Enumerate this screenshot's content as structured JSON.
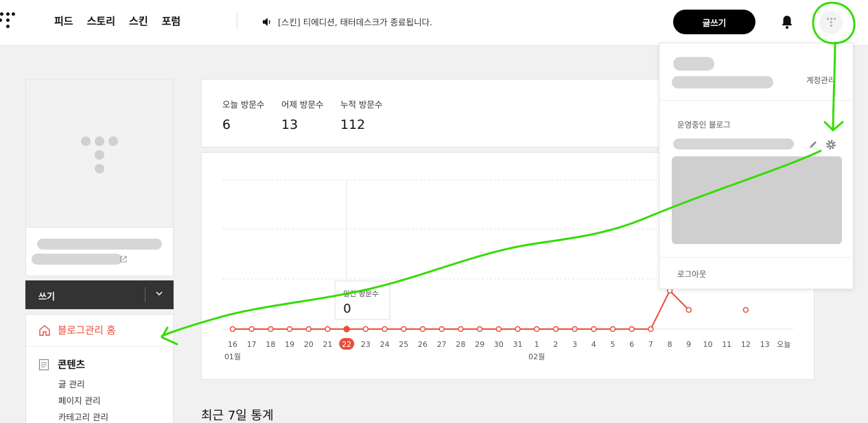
{
  "topbar": {
    "nav": [
      "피드",
      "스토리",
      "스킨",
      "포럼"
    ],
    "notice": "[스킨] 티에디션, 태터데스크가 종료됩니다.",
    "write_button": "글쓰기"
  },
  "sidebar": {
    "write_label": "쓰기",
    "home_label": "블로그관리 홈",
    "content_label": "콘텐츠",
    "content_items": [
      "글 관리",
      "페이지 관리",
      "카테고리 관리"
    ]
  },
  "stats": {
    "today_label": "오늘 방문수",
    "today_value": "6",
    "yesterday_label": "어제 방문수",
    "yesterday_value": "13",
    "total_label": "누적 방문수",
    "total_value": "112"
  },
  "chart_data": {
    "type": "line",
    "categories": [
      "16",
      "17",
      "18",
      "19",
      "20",
      "21",
      "22",
      "23",
      "24",
      "25",
      "26",
      "27",
      "28",
      "29",
      "30",
      "31",
      "1",
      "2",
      "3",
      "4",
      "5",
      "6",
      "7",
      "8",
      "9",
      "10",
      "11",
      "12",
      "13",
      "오늘"
    ],
    "month_labels": [
      "01월",
      "02월"
    ],
    "series": [
      {
        "values": [
          0,
          0,
          0,
          0,
          0,
          0,
          0,
          0,
          0,
          0,
          0,
          0,
          0,
          0,
          0,
          0,
          0,
          0,
          0,
          0,
          0,
          0,
          0,
          4,
          2,
          null,
          null,
          2,
          null,
          null
        ]
      }
    ],
    "highlight_index": 6,
    "tooltip_label": "일간 방문수",
    "tooltip_value": "0",
    "color": "#e94e3b"
  },
  "recent": {
    "title": "최근 7일 통계"
  },
  "dropdown": {
    "manage_label": "계정관리",
    "running_label": "운영중인 블로그",
    "logout_label": "로그아웃"
  }
}
